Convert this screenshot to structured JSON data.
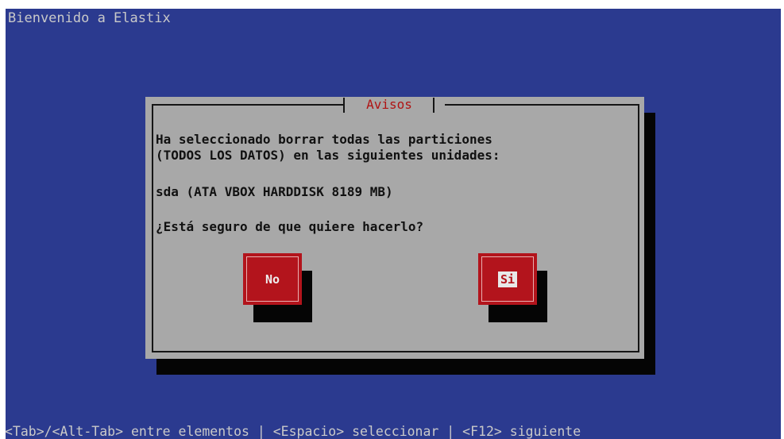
{
  "screen": {
    "title": "Bienvenido a Elastix",
    "help_bar": "<Tab>/<Alt-Tab> entre elementos | <Espacio> seleccionar | <F12> siguiente"
  },
  "dialog": {
    "title": "Avisos",
    "message_line1": "Ha seleccionado borrar todas las particiones",
    "message_line2": "(TODOS LOS DATOS) en las siguientes unidades:",
    "drive": "sda (ATA VBOX HARDDISK 8189 MB)",
    "question": "¿Está seguro de que quiere hacerlo?",
    "buttons": {
      "no_label": "No",
      "yes_label": "Si"
    }
  },
  "colors": {
    "background": "#2b3a8f",
    "dialog": "#a8a8a8",
    "button": "#b3141c",
    "title_accent": "#b01414",
    "shadow": "#050505"
  }
}
